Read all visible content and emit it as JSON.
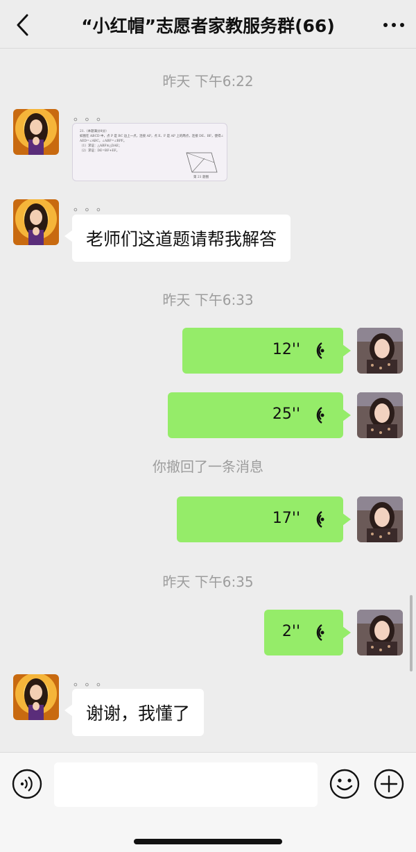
{
  "header": {
    "title": "“小红帽”志愿者家教服务群(66)",
    "back_icon": "chevron-left-icon",
    "more_icon": "ellipsis-icon"
  },
  "timestamps": [
    "昨天 下午6:22",
    "昨天 下午6:33",
    "昨天 下午6:35"
  ],
  "messages": {
    "m1": {
      "sender": "。。。",
      "type": "image",
      "image_lines": [
        "21.（本题满分8分）",
        "如图在 ABCD 中，点 P 是 BC 边上一点，连接 AP，点 E、F 是 AP 上的两点，连接 DE、BF，使得∠",
        "AED=∠ABC，∠ABF=∠BPF。",
        "（1）求证：△ABF≌△DAE；",
        "（2）求证：DE=BF+EF。"
      ],
      "image_caption": "第 21 题图"
    },
    "m2": {
      "sender": "。。。",
      "type": "text",
      "text": "老师们这道题请帮我解答"
    },
    "v1": {
      "type": "voice",
      "duration": "12''"
    },
    "v2": {
      "type": "voice",
      "duration": "25''"
    },
    "recall": "你撤回了一条消息",
    "v3": {
      "type": "voice",
      "duration": "17''"
    },
    "v4": {
      "type": "voice",
      "duration": "2''"
    },
    "m3": {
      "sender": "。。。",
      "type": "text",
      "text": "谢谢，我懂了"
    }
  },
  "input_bar": {
    "voice_icon": "voice-mode-icon",
    "emoji_icon": "emoji-icon",
    "plus_icon": "plus-circle-icon",
    "placeholder": ""
  },
  "colors": {
    "background": "#ededed",
    "out_bubble": "#95ec69",
    "in_bubble": "#ffffff",
    "meta_text": "#9d9d9d"
  }
}
